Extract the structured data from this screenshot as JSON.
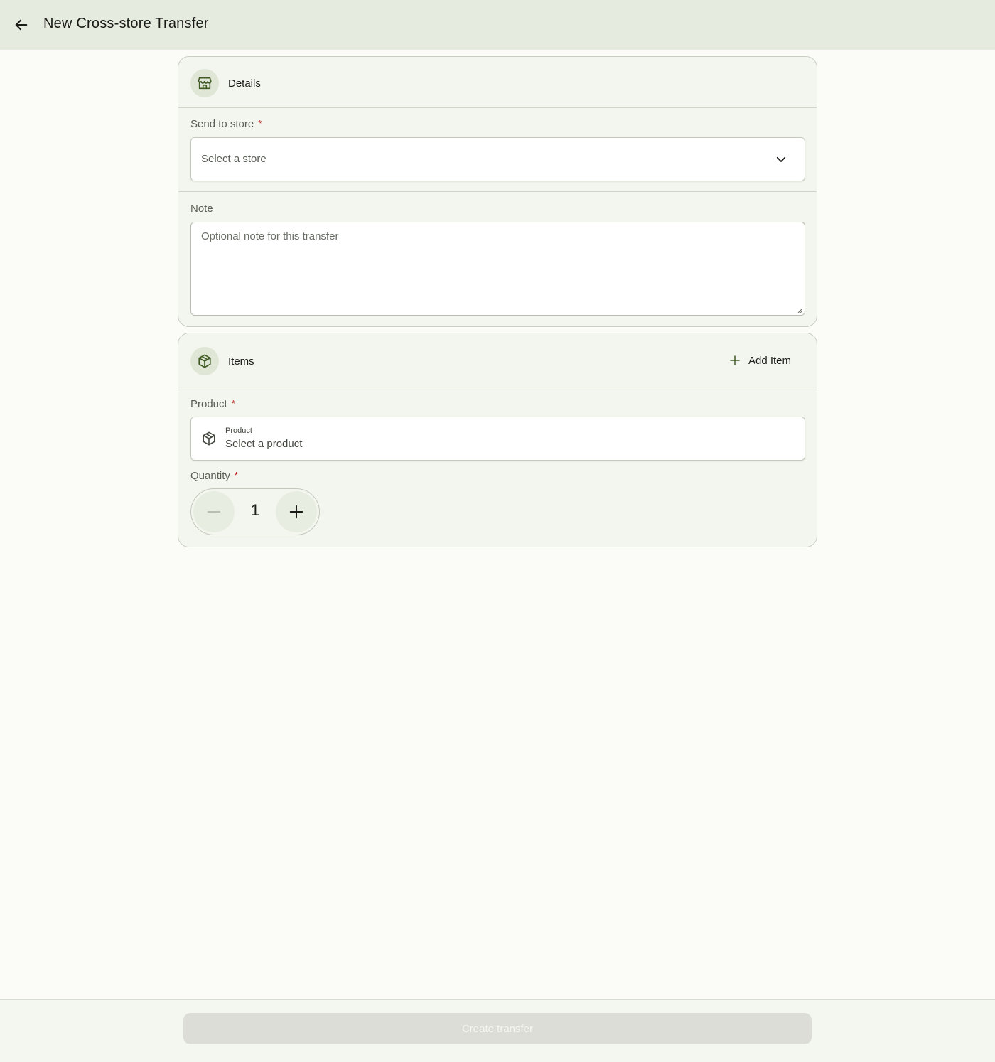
{
  "header": {
    "title": "New Cross-store Transfer"
  },
  "details": {
    "title": "Details",
    "store_label": "Send to store",
    "required_mark": "*",
    "store_placeholder": "Select a store",
    "note_label": "Note",
    "note_placeholder": "Optional note for this transfer"
  },
  "items": {
    "title": "Items",
    "add_item_label": "Add Item",
    "product_label": "Product",
    "product_field_small_label": "Product",
    "product_placeholder": "Select a product",
    "quantity_label": "Quantity",
    "quantity_value": "1"
  },
  "footer": {
    "create_label": "Create transfer"
  },
  "colors": {
    "accent": "#4c662b",
    "required": "#ba1a1a",
    "topbar": "#e6ebe0",
    "card": "#f3f6ee"
  },
  "icons": [
    "back-arrow-icon",
    "store-icon",
    "chevron-down-icon",
    "package-icon",
    "plus-icon",
    "minus-icon"
  ]
}
